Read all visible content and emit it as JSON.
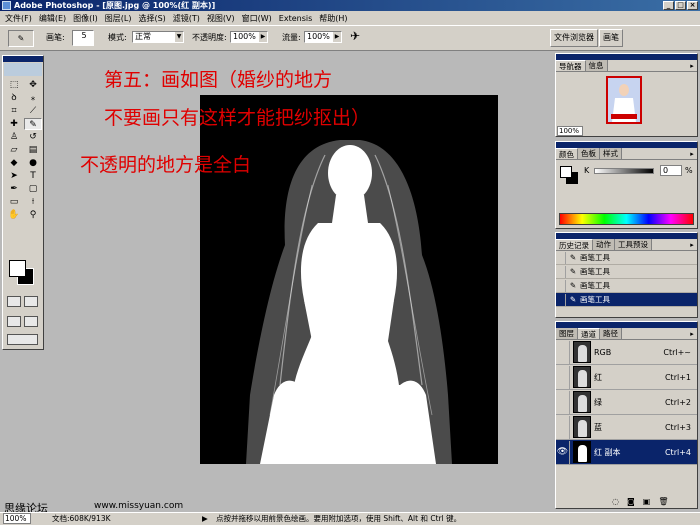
{
  "window": {
    "title": "Adobe Photoshop - [原图.jpg @ 100%(红 副本)]",
    "buttons": [
      "_",
      "□",
      "×"
    ]
  },
  "menu": [
    "文件(F)",
    "编辑(E)",
    "图像(I)",
    "图层(L)",
    "选择(S)",
    "滤镜(T)",
    "视图(V)",
    "窗口(W)",
    "Extensis",
    "帮助(H)"
  ],
  "options": {
    "brush_label": "画笔:",
    "brush_size": "5",
    "mode_label": "模式:",
    "mode_value": "正常",
    "opacity_label": "不透明度:",
    "opacity_value": "100%",
    "flow_label": "流量:",
    "flow_value": "100%"
  },
  "palette_well": [
    "文件浏览器",
    "画笔"
  ],
  "annotations": {
    "line1": "第五：画如图（婚纱的地方",
    "line2": "不要画只有这样才能把纱抠出）",
    "line3": "不透明的地方是全白"
  },
  "navigator": {
    "tabs": [
      "导航器",
      "信息"
    ],
    "zoom": "100%"
  },
  "color_panel": {
    "tabs": [
      "颜色",
      "色板",
      "样式"
    ],
    "channel": "K",
    "value": "0",
    "unit": "%"
  },
  "history": {
    "tabs": [
      "历史记录",
      "动作",
      "工具预设"
    ],
    "items": [
      {
        "label": "画笔工具",
        "selected": false
      },
      {
        "label": "画笔工具",
        "selected": false
      },
      {
        "label": "画笔工具",
        "selected": false
      },
      {
        "label": "画笔工具",
        "selected": true
      }
    ]
  },
  "channels": {
    "tabs": [
      "图层",
      "通道",
      "路径"
    ],
    "rows": [
      {
        "name": "RGB",
        "shortcut": "Ctrl+~",
        "visible": false,
        "selected": false
      },
      {
        "name": "红",
        "shortcut": "Ctrl+1",
        "visible": false,
        "selected": false
      },
      {
        "name": "绿",
        "shortcut": "Ctrl+2",
        "visible": false,
        "selected": false
      },
      {
        "name": "蓝",
        "shortcut": "Ctrl+3",
        "visible": false,
        "selected": false
      },
      {
        "name": "红 副本",
        "shortcut": "Ctrl+4",
        "visible": true,
        "selected": true
      }
    ]
  },
  "status": {
    "zoom": "100%",
    "doc": "文档:608K/913K",
    "hint": "点按并拖移以用前景色绘画。要用附加选项，使用 Shift、Alt 和 Ctrl 键。"
  },
  "watermark": {
    "site": "思缘论坛",
    "url": "www.missyuan.com"
  },
  "colors": {
    "annotation": "#e00000",
    "title_blue": "#0a246a",
    "ui_gray": "#d4d0c8",
    "workspace": "#b9b9b9"
  }
}
